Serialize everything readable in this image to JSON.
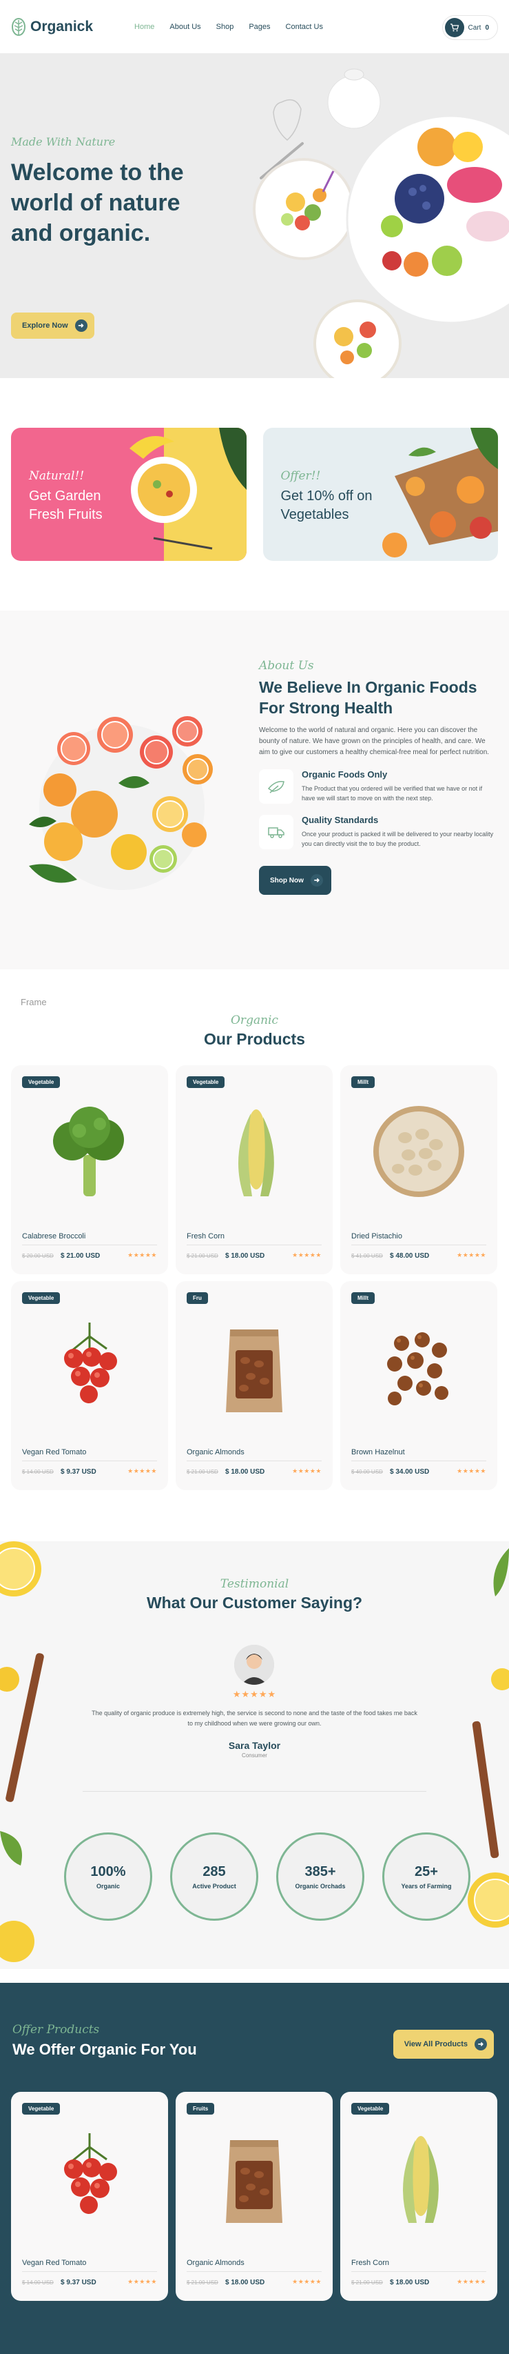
{
  "header": {
    "logo": "Organick",
    "nav": [
      "Home",
      "About Us",
      "Shop",
      "Pages",
      "Contact Us"
    ],
    "cart_label": "Cart",
    "cart_count": "0"
  },
  "hero": {
    "subtitle": "Made With Nature",
    "title": "Welcome to the world of nature and organic.",
    "button": "Explore Now"
  },
  "banners": [
    {
      "subtitle": "Natural!!",
      "title": "Get Garden Fresh Fruits"
    },
    {
      "subtitle": "Offer!!",
      "title": "Get 10% off on Vegetables"
    }
  ],
  "about": {
    "subtitle": "About Us",
    "title": "We Believe In Organic Foods For Strong Health",
    "text": "Welcome to the world of natural and organic. Here you can discover the bounty of nature. We have grown on the principles of health, and care. We aim to give our customers a healthy chemical-free meal for perfect nutrition.",
    "features": [
      {
        "title": "Organic Foods Only",
        "text": "The Product that you ordered will be verified that we have or not if have we will start to move on with the next step."
      },
      {
        "title": "Quality Standards",
        "text": "Once your product is packed it will be delivered to your nearby locality you can directly visit the to buy the product."
      }
    ],
    "button": "Shop Now"
  },
  "products": {
    "frame_label": "Frame",
    "subtitle": "Organic",
    "title": "Our Products",
    "items": [
      {
        "badge": "Vegetable",
        "name": "Calabrese Broccoli",
        "old_price": "$ 20.00 USD",
        "price": "$ 21.00 USD",
        "img": "broccoli"
      },
      {
        "badge": "Vegetable",
        "name": "Fresh Corn",
        "old_price": "$ 21.00 USD",
        "price": "$ 18.00 USD",
        "img": "corn"
      },
      {
        "badge": "Millt",
        "name": "Dried Pistachio",
        "old_price": "$ 41.00 USD",
        "price": "$ 48.00 USD",
        "img": "pistachio"
      },
      {
        "badge": "Vegetable",
        "name": "Vegan Red Tomato",
        "old_price": "$ 14.00 USD",
        "price": "$ 9.37 USD",
        "img": "tomato"
      },
      {
        "badge": "Fru",
        "name": "Organic Almonds",
        "old_price": "$ 21.00 USD",
        "price": "$ 18.00 USD",
        "img": "almonds"
      },
      {
        "badge": "Millt",
        "name": "Brown Hazelnut",
        "old_price": "$ 40.00 USD",
        "price": "$ 34.00 USD",
        "img": "hazelnut"
      }
    ]
  },
  "testimonial": {
    "subtitle": "Testimonial",
    "title": "What Our Customer Saying?",
    "stars": "★★★★★",
    "quote": "The quality of organic produce is extremely high, the service is second to none and the taste of the food takes me back to my childhood when we were growing our own.",
    "name": "Sara Taylor",
    "role": "Consumer",
    "stats": [
      {
        "num": "100%",
        "label": "Organic"
      },
      {
        "num": "285",
        "label": "Active Product"
      },
      {
        "num": "385+",
        "label": "Organic Orchads"
      },
      {
        "num": "25+",
        "label": "Years of Farming"
      }
    ]
  },
  "offer": {
    "subtitle": "Offer Products",
    "title": "We Offer Organic For You",
    "button": "View All Products",
    "items": [
      {
        "badge": "Vegetable",
        "name": "Vegan Red Tomato",
        "old_price": "$ 14.00 USD",
        "price": "$ 9.37 USD",
        "img": "tomato"
      },
      {
        "badge": "Fruits",
        "name": "Organic Almonds",
        "old_price": "$ 21.00 USD",
        "price": "$ 18.00 USD",
        "img": "almonds"
      },
      {
        "badge": "Vegetable",
        "name": "Fresh Corn",
        "old_price": "$ 21.00 USD",
        "price": "$ 18.00 USD",
        "img": "corn"
      }
    ]
  },
  "colors": {
    "brand": "#274c5b",
    "accent": "#7eb693",
    "yellow": "#efd372",
    "star": "#ffa858"
  }
}
